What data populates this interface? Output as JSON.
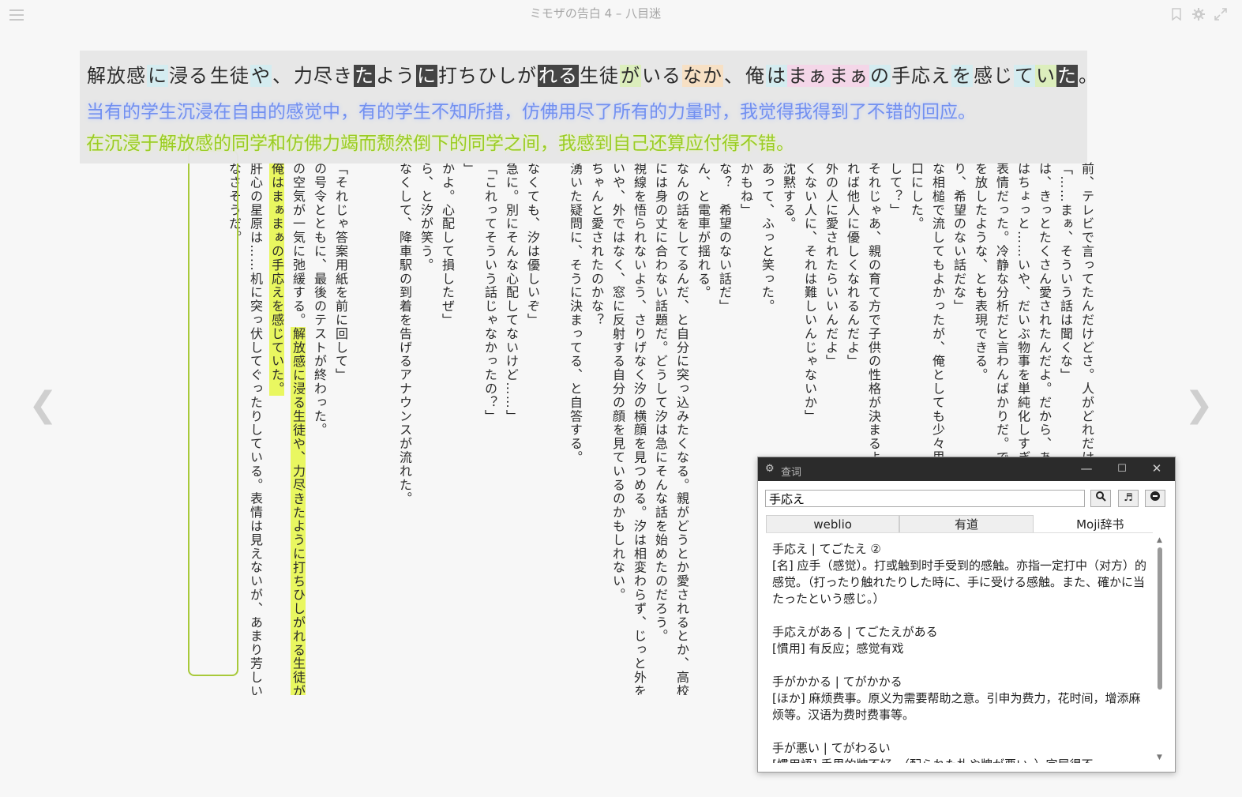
{
  "header": {
    "title": "ミモザの告白 4 – 八目迷"
  },
  "icons": {
    "menu": "hamburger-menu-icon",
    "bookmark": "bookmark-icon",
    "settings": "gear-icon",
    "fullscreen": "expand-icon",
    "prev": "chevron-left-icon",
    "next": "chevron-right-icon"
  },
  "nav": {
    "prev": "❮",
    "next": "❯"
  },
  "overlay": {
    "jp_segments": [
      {
        "t": "解放感",
        "c": "c0"
      },
      {
        "t": "に",
        "c": "c1"
      },
      {
        "t": "浸る",
        "c": "c0"
      },
      {
        "t": "生徒",
        "c": "c0"
      },
      {
        "t": "や",
        "c": "c1"
      },
      {
        "t": "、",
        "c": "c0"
      },
      {
        "t": "力尽き",
        "c": "c0"
      },
      {
        "t": "た",
        "c": "c5"
      },
      {
        "t": "よう",
        "c": "c0"
      },
      {
        "t": "に",
        "c": "c5"
      },
      {
        "t": "打ちひしが",
        "c": "c0"
      },
      {
        "t": "れる",
        "c": "c5"
      },
      {
        "t": "生徒",
        "c": "c0"
      },
      {
        "t": "が",
        "c": "c3"
      },
      {
        "t": "いる",
        "c": "c0"
      },
      {
        "t": "なか",
        "c": "c4"
      },
      {
        "t": "、",
        "c": "c0"
      },
      {
        "t": "俺",
        "c": "c0"
      },
      {
        "t": "は",
        "c": "c1"
      },
      {
        "t": "まぁ",
        "c": "c2"
      },
      {
        "t": "まぁ",
        "c": "c2"
      },
      {
        "t": "の",
        "c": "c1"
      },
      {
        "t": "手応え",
        "c": "c0"
      },
      {
        "t": "を",
        "c": "c1"
      },
      {
        "t": "感じ",
        "c": "c0"
      },
      {
        "t": "て",
        "c": "c1"
      },
      {
        "t": "い",
        "c": "c3"
      },
      {
        "t": "た",
        "c": "c5"
      },
      {
        "t": "。",
        "c": "c0"
      }
    ],
    "cn1": "当有的学生沉浸在自由的感觉中，有的学生不知所措，仿佛用尽了所有的力量时，我觉得我得到了不错的回应。",
    "cn2": "在沉浸于解放感的同学和仿佛力竭而颓然倒下的同学之间，我感到自己还算应付得不错。"
  },
  "columns": [
    "前、テレビで言ってたんだけどさ。人がどれだけ他人",
    "「……まぁ、そういう話は聞くな」",
    "は、きっとたくさん愛されたんだよ。だから、あんな",
    "はちょっと……いや、だいぶ物事を単純化しすぎじゃ",
    "表情だった。冷静な分析だと言わんばかりだ。でも",
    "を放したような、とも表現できる。",
    "り、希望のない話だな」",
    "な相槌で流してもよかったが、俺としても少々思う",
    "口にした。",
    "して？」",
    "それじゃあ、親の育て方で子供の性格が決まるよう",
    "れば他人に優しくなれるんだよ」",
    "外の人に愛されたらいいんだよ」",
    "くない人に、それは難しいんじゃないか」",
    "沈黙する。",
    "あって、ふっと笑った。",
    "かもね」",
    "な？　希望のない話だ」",
    "ん、と電車が揺れる。",
    "なんの話をしてるんだ、と自分に突っ込みたくなる。親がどうとか愛されるとか、高校生の",
    "には身の丈に合わない話題だ。どうして汐は急にそんな話を始めたのだろう。",
    "視線を悟られないよう、さりげなく汐の横顔を見つめる。汐は相変わらず、じっと外を眺め",
    "いや、外ではなく、窓に反射する自分の顔を見ているのかもしれない。",
    "ちゃんと愛されたのかな？",
    "湧いた疑問に、そうに決まってる、と自答する。",
    "",
    "なくても、汐は優しいぞ」",
    "急に。別にそんな心配してないけど……」",
    "「これってそういう話じゃなかったの？」",
    "」",
    "かよ。心配して損したぜ」",
    "ら、と汐が笑う。",
    "なくして、降車駅の到着を告げるアナウンスが流れた。",
    "",
    "",
    "「それじゃ答案用紙を前に回して」",
    "の号令とともに、最後のテストが終わった。",
    "の空気が一気に弛緩する。解放感に浸る生徒や、力尽きたように打ちひしがれる生徒がい",
    "俺はまぁまぁの手応えを感じていた。",
    "肝心の星原は……机に突っ伏してぐったりしている。表情は見えないが、あまり芳しい結",
    "なさそうだ。"
  ],
  "dictionary": {
    "window_title": "查词",
    "title_icon": "gear-icon",
    "minimize": "—",
    "maximize": "☐",
    "close": "✕",
    "search_value": "手応え",
    "search_button_icon": "search-icon",
    "audio_button_icon": "music-note-icon",
    "extra_button_icon": "circle-icon",
    "tabs": [
      "weblio",
      "有道",
      "Moji辞书"
    ],
    "active_tab": 2,
    "entries": [
      {
        "head": "手応え | てごたえ ②",
        "body": "[名] 应手（感觉）。打或触到时手受到的感触。亦指一定打中（对方）的感觉。（打ったり触れたりした時に、手に受ける感触。また、確かに当たったという感じ。）"
      },
      {
        "head": "手応えがある | てごたえがある",
        "body": "[慣用] 有反应；感觉有戏"
      },
      {
        "head": "手がかかる | てがかかる",
        "body": "[ほか] 麻烦费事。原义为需要帮助之意。引申为费力，花时间，增添麻烦等。汉语为费时费事等。"
      },
      {
        "head": "手が悪い | てがわるい",
        "body": "[慣用語] 手里的牌不好。（配られた札や牌が悪い。）字屋得不"
      }
    ]
  }
}
